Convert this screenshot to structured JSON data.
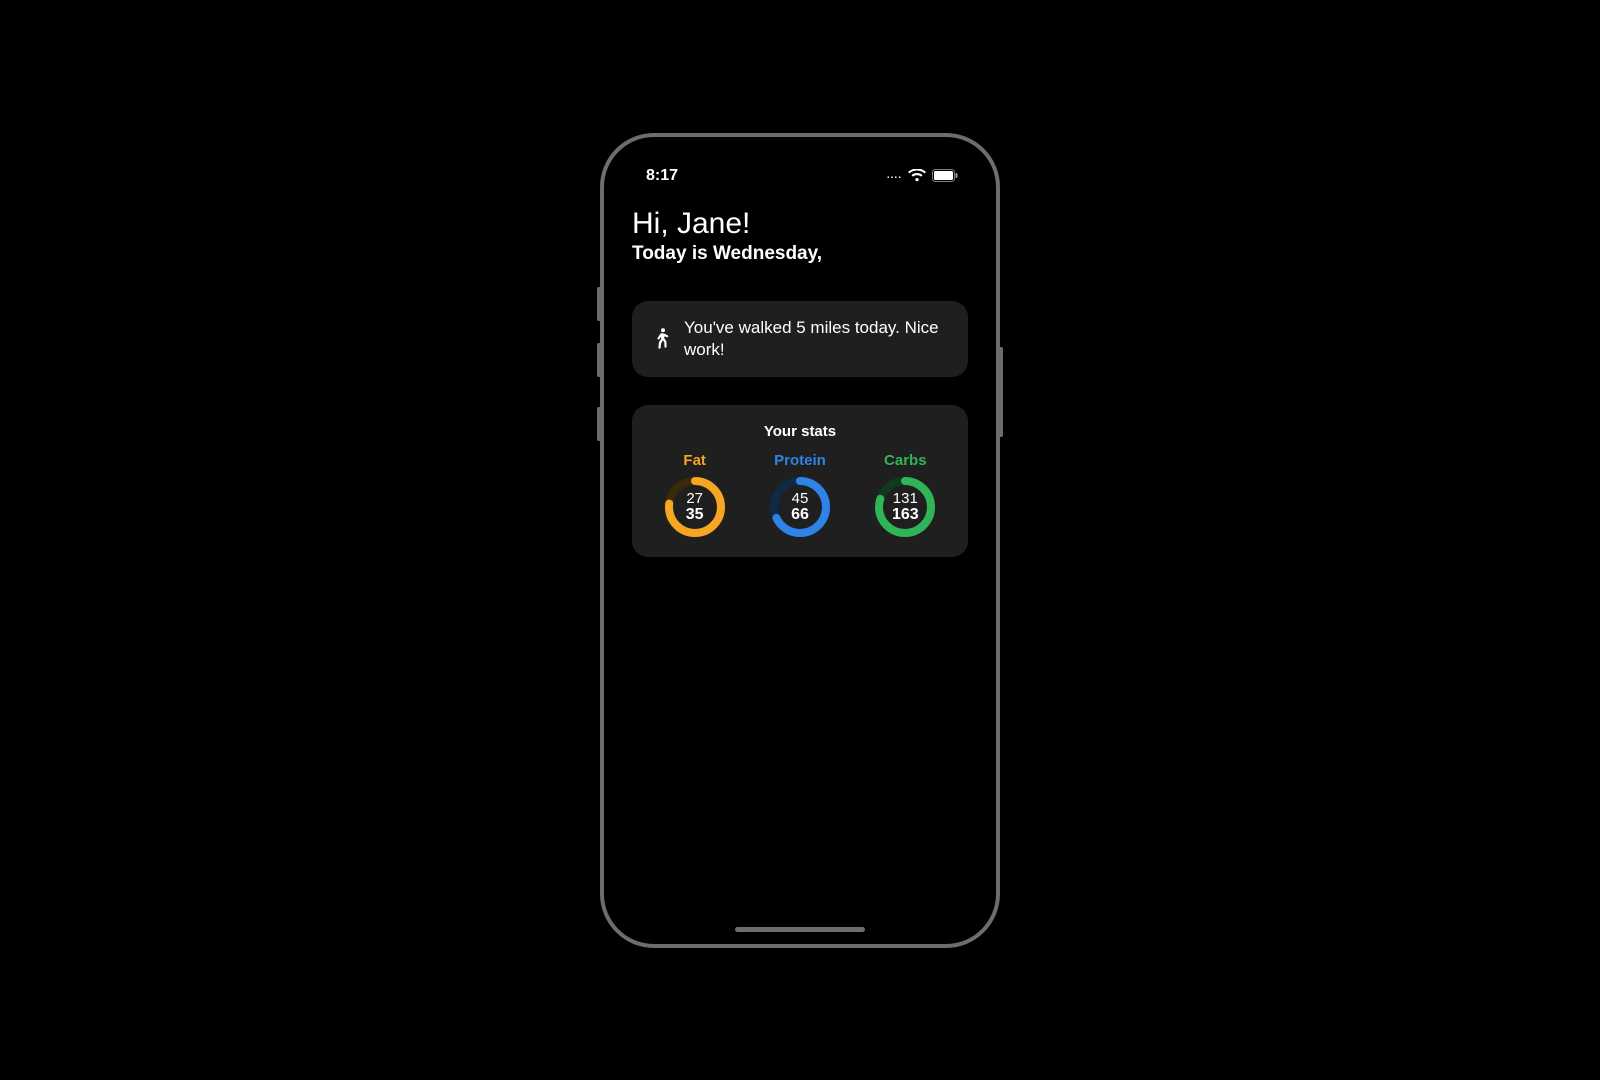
{
  "status_bar": {
    "time": "8:17",
    "signal_dots": "....",
    "wifi": true,
    "battery": true
  },
  "greeting": "Hi, Jane!",
  "today_line": "Today is Wednesday,",
  "notification": {
    "icon": "walking-icon",
    "text": "You've walked 5 miles today. Nice work!"
  },
  "stats": {
    "title": "Your stats",
    "items": [
      {
        "label": "Fat",
        "color": "#f5a623",
        "track": "#3a2a0a",
        "current": 27,
        "target": 35,
        "fraction": 0.77
      },
      {
        "label": "Protein",
        "color": "#2e84e6",
        "track": "#0f2a46",
        "current": 45,
        "target": 66,
        "fraction": 0.68
      },
      {
        "label": "Carbs",
        "color": "#2fb558",
        "track": "#0f3a1e",
        "current": 131,
        "target": 163,
        "fraction": 0.8
      }
    ]
  }
}
